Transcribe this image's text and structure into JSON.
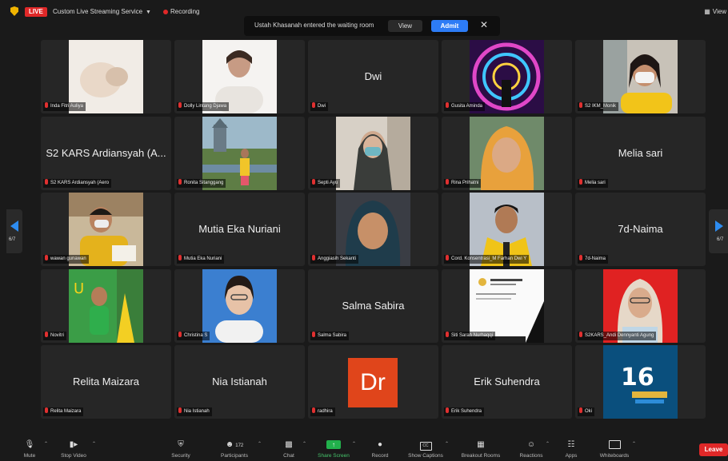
{
  "topbar": {
    "live_badge": "LIVE",
    "stream_title": "Custom Live Streaming Service",
    "recording_label": "Recording",
    "view_label": "View"
  },
  "notification": {
    "text": "Ustah Khasanah entered the waiting room",
    "view_button": "View",
    "admit_button": "Admit",
    "close_glyph": "✕"
  },
  "pagination": {
    "left_page": "6/7",
    "right_page": "6/7"
  },
  "participants": [
    {
      "label": "Inda Fitri Auliya",
      "center_name": "",
      "video": "video-lace"
    },
    {
      "label": "Dolly Lintang Djawa",
      "center_name": "",
      "video": "video-woman-white-bg"
    },
    {
      "label": "Dwi",
      "center_name": "Dwi",
      "video": ""
    },
    {
      "label": "Gusita Aminda",
      "center_name": "",
      "video": "video-light-tunnel"
    },
    {
      "label": "S2 IKM_Monik",
      "center_name": "",
      "video": "video-woman-mask"
    },
    {
      "label": "S2 KARS Ardiansyah (Aero",
      "center_name": "S2 KARS Ardiansyah (A...",
      "video": ""
    },
    {
      "label": "Ronita Sitanggang",
      "center_name": "",
      "video": "video-park"
    },
    {
      "label": "Septi Ayu",
      "center_name": "",
      "video": "video-hijab-mask"
    },
    {
      "label": "Rina Prihatni",
      "center_name": "",
      "video": "video-hijab-smile"
    },
    {
      "label": "Melia sari",
      "center_name": "Melia sari",
      "video": ""
    },
    {
      "label": "wawan gunawan",
      "center_name": "",
      "video": "video-man-mask-yellow"
    },
    {
      "label": "Mutia Eka Nuriani",
      "center_name": "Mutia Eka Nuriani",
      "video": ""
    },
    {
      "label": "Anggiasih Sekanti",
      "center_name": "",
      "video": "video-hijab-dark"
    },
    {
      "label": "Cord. Konsentrasi_M Farhan Dwi Y",
      "center_name": "",
      "video": "video-man-yellow-jacket"
    },
    {
      "label": "7d-Naima",
      "center_name": "7d-Naima",
      "video": ""
    },
    {
      "label": "Novitri",
      "center_name": "",
      "video": "video-green-backdrop"
    },
    {
      "label": "Christina S",
      "center_name": "",
      "video": "video-woman-blue-bg"
    },
    {
      "label": "Salma Sabira",
      "center_name": "Salma Sabira",
      "video": ""
    },
    {
      "label": "Siti Sarah Nurhaqqi",
      "center_name": "",
      "video": "video-document"
    },
    {
      "label": "S2KARS_Andi Dennyanti Agung",
      "center_name": "",
      "video": "video-hijab-red-bg"
    },
    {
      "label": "Relita Maizara",
      "center_name": "Relita Maizara",
      "video": ""
    },
    {
      "label": "Nia Istianah",
      "center_name": "Nia Istianah",
      "video": ""
    },
    {
      "label": "radhira",
      "center_name": "",
      "video": "",
      "avatar": "Dr"
    },
    {
      "label": "Erik Suhendra",
      "center_name": "Erik Suhendra",
      "video": ""
    },
    {
      "label": "Oki",
      "center_name": "",
      "video": "video-poster"
    }
  ],
  "toolbar": {
    "mute": "Mute",
    "stop_video": "Stop Video",
    "security": "Security",
    "participants": "Participants",
    "participants_count": "172",
    "chat": "Chat",
    "share_screen": "Share Screen",
    "record": "Record",
    "show_captions": "Show Captions",
    "breakout_rooms": "Breakout Rooms",
    "reactions": "Reactions",
    "apps": "Apps",
    "whiteboards": "Whiteboards",
    "leave": "Leave"
  },
  "colors": {
    "accent_blue": "#2d7cf6",
    "live_red": "#e02828",
    "share_green": "#22b14c",
    "avatar_orange": "#e0451b"
  }
}
